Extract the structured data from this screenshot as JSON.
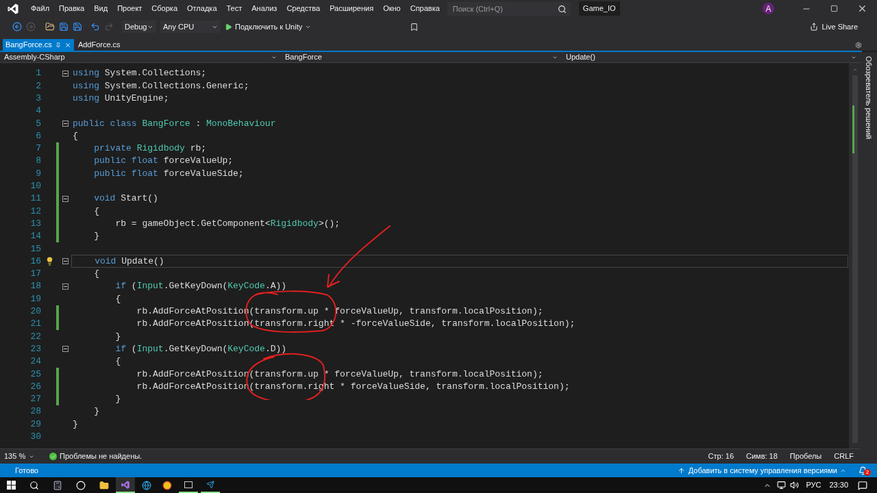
{
  "menu": [
    "Файл",
    "Правка",
    "Вид",
    "Проект",
    "Сборка",
    "Отладка",
    "Тест",
    "Анализ",
    "Средства",
    "Расширения",
    "Окно",
    "Справка"
  ],
  "search": {
    "placeholder": "Поиск (Ctrl+Q)"
  },
  "solution_name": "Game_IO",
  "account_initial": "A",
  "toolbar": {
    "configuration": "Debug",
    "platform": "Any CPU",
    "run_label": "Подключить к Unity",
    "live_share": "Live Share"
  },
  "tabs": [
    {
      "label": "BangForce.cs",
      "selected": true
    },
    {
      "label": "AddForce.cs",
      "selected": false
    }
  ],
  "nav": {
    "project": "Assembly-CSharp",
    "class": "BangForce",
    "member": "Update()"
  },
  "side_panel": "Обозреватель решений",
  "lines": [
    {
      "number": "1",
      "fold": true,
      "changed": false,
      "current": false,
      "tokens": [
        {
          "kind": "kw",
          "text": "using"
        },
        {
          "kind": "plain",
          "text": " System.Collections;"
        }
      ]
    },
    {
      "number": "2",
      "fold": false,
      "changed": false,
      "current": false,
      "tokens": [
        {
          "kind": "kw",
          "text": "using"
        },
        {
          "kind": "plain",
          "text": " System.Collections.Generic;"
        }
      ]
    },
    {
      "number": "3",
      "fold": false,
      "changed": false,
      "current": false,
      "tokens": [
        {
          "kind": "kw",
          "text": "using"
        },
        {
          "kind": "plain",
          "text": " UnityEngine;"
        }
      ]
    },
    {
      "number": "4",
      "fold": false,
      "changed": false,
      "current": false
    },
    {
      "number": "5",
      "fold": true,
      "changed": false,
      "current": false,
      "tokens": [
        {
          "kind": "kw",
          "text": "public class "
        },
        {
          "kind": "type",
          "text": "BangForce"
        },
        {
          "kind": "plain",
          "text": " : "
        },
        {
          "kind": "type",
          "text": "MonoBehaviour"
        }
      ]
    },
    {
      "number": "6",
      "fold": false,
      "changed": false,
      "current": false,
      "tokens": [
        {
          "kind": "plain",
          "text": "{"
        }
      ]
    },
    {
      "number": "7",
      "fold": false,
      "changed": true,
      "current": false,
      "tokens": [
        {
          "kind": "kw",
          "text": "    private "
        },
        {
          "kind": "type",
          "text": "Rigidbody"
        },
        {
          "kind": "plain",
          "text": " rb;"
        }
      ]
    },
    {
      "number": "8",
      "fold": false,
      "changed": true,
      "current": false,
      "tokens": [
        {
          "kind": "kw",
          "text": "    public float"
        },
        {
          "kind": "plain",
          "text": " forceValueUp;"
        }
      ]
    },
    {
      "number": "9",
      "fold": false,
      "changed": true,
      "current": false,
      "tokens": [
        {
          "kind": "kw",
          "text": "    public float"
        },
        {
          "kind": "plain",
          "text": " forceValueSide;"
        }
      ]
    },
    {
      "number": "10",
      "fold": false,
      "changed": true,
      "current": false
    },
    {
      "number": "11",
      "fold": true,
      "changed": true,
      "current": false,
      "tokens": [
        {
          "kind": "kw",
          "text": "    void"
        },
        {
          "kind": "plain",
          "text": " Start()"
        }
      ]
    },
    {
      "number": "12",
      "fold": false,
      "changed": true,
      "current": false,
      "tokens": [
        {
          "kind": "plain",
          "text": "    {"
        }
      ]
    },
    {
      "number": "13",
      "fold": false,
      "changed": true,
      "current": false,
      "tokens": [
        {
          "kind": "plain",
          "text": "        rb = gameObject.GetComponent<"
        },
        {
          "kind": "type",
          "text": "Rigidbody"
        },
        {
          "kind": "plain",
          "text": ">();"
        }
      ]
    },
    {
      "number": "14",
      "fold": false,
      "changed": true,
      "current": false,
      "tokens": [
        {
          "kind": "plain",
          "text": "    }"
        }
      ]
    },
    {
      "number": "15",
      "fold": false,
      "changed": false,
      "current": false
    },
    {
      "number": "16",
      "fold": true,
      "changed": false,
      "current": true,
      "tokens": [
        {
          "kind": "kw",
          "text": "    void"
        },
        {
          "kind": "plain",
          "text": " Update()"
        }
      ]
    },
    {
      "number": "17",
      "fold": false,
      "changed": false,
      "current": false,
      "tokens": [
        {
          "kind": "plain",
          "text": "    {"
        }
      ]
    },
    {
      "number": "18",
      "fold": true,
      "changed": false,
      "current": false,
      "tokens": [
        {
          "kind": "kw",
          "text": "        if"
        },
        {
          "kind": "plain",
          "text": " ("
        },
        {
          "kind": "type",
          "text": "Input"
        },
        {
          "kind": "plain",
          "text": ".GetKeyDown("
        },
        {
          "kind": "type",
          "text": "KeyCode"
        },
        {
          "kind": "plain",
          "text": ".A))"
        }
      ]
    },
    {
      "number": "19",
      "fold": false,
      "changed": false,
      "current": false,
      "tokens": [
        {
          "kind": "plain",
          "text": "        {"
        }
      ]
    },
    {
      "number": "20",
      "fold": false,
      "changed": true,
      "current": false,
      "tokens": [
        {
          "kind": "plain",
          "text": "            rb.AddForceAtPosition(transform.up * forceValueUp, transform.localPosition);"
        }
      ]
    },
    {
      "number": "21",
      "fold": false,
      "changed": true,
      "current": false,
      "tokens": [
        {
          "kind": "plain",
          "text": "            rb.AddForceAtPosition(transform.right * -forceValueSide, transform.localPosition);"
        }
      ]
    },
    {
      "number": "22",
      "fold": false,
      "changed": false,
      "current": false,
      "tokens": [
        {
          "kind": "plain",
          "text": "        }"
        }
      ]
    },
    {
      "number": "23",
      "fold": true,
      "changed": false,
      "current": false,
      "tokens": [
        {
          "kind": "kw",
          "text": "        if"
        },
        {
          "kind": "plain",
          "text": " ("
        },
        {
          "kind": "type",
          "text": "Input"
        },
        {
          "kind": "plain",
          "text": ".GetKeyDown("
        },
        {
          "kind": "type",
          "text": "KeyCode"
        },
        {
          "kind": "plain",
          "text": ".D))"
        }
      ]
    },
    {
      "number": "24",
      "fold": false,
      "changed": false,
      "current": false,
      "tokens": [
        {
          "kind": "plain",
          "text": "        {"
        }
      ]
    },
    {
      "number": "25",
      "fold": false,
      "changed": true,
      "current": false,
      "tokens": [
        {
          "kind": "plain",
          "text": "            rb.AddForceAtPosition(transform.up * forceValueUp, transform.localPosition);"
        }
      ]
    },
    {
      "number": "26",
      "fold": false,
      "changed": true,
      "current": false,
      "tokens": [
        {
          "kind": "plain",
          "text": "            rb.AddForceAtPosition(transform.right * forceValueSide, transform.localPosition);"
        }
      ]
    },
    {
      "number": "27",
      "fold": false,
      "changed": true,
      "current": false,
      "tokens": [
        {
          "kind": "plain",
          "text": "        }"
        }
      ]
    },
    {
      "number": "28",
      "fold": false,
      "changed": false,
      "current": false,
      "tokens": [
        {
          "kind": "plain",
          "text": "    }"
        }
      ]
    },
    {
      "number": "29",
      "fold": false,
      "changed": false,
      "current": false,
      "tokens": [
        {
          "kind": "plain",
          "text": "}"
        }
      ]
    },
    {
      "number": "30",
      "fold": false,
      "changed": false,
      "current": false
    }
  ],
  "editor_status": {
    "zoom": "135 %",
    "problems": "Проблемы не найдены.",
    "line": "Стр: 16",
    "column": "Симв: 18",
    "whitespace": "Пробелы",
    "line_endings": "CRLF"
  },
  "status_bar": {
    "state": "Готово",
    "source_control": "Добавить в систему управления версиями",
    "notifications": "2"
  },
  "taskbar": {
    "language": "РУС",
    "time": "23:30"
  }
}
